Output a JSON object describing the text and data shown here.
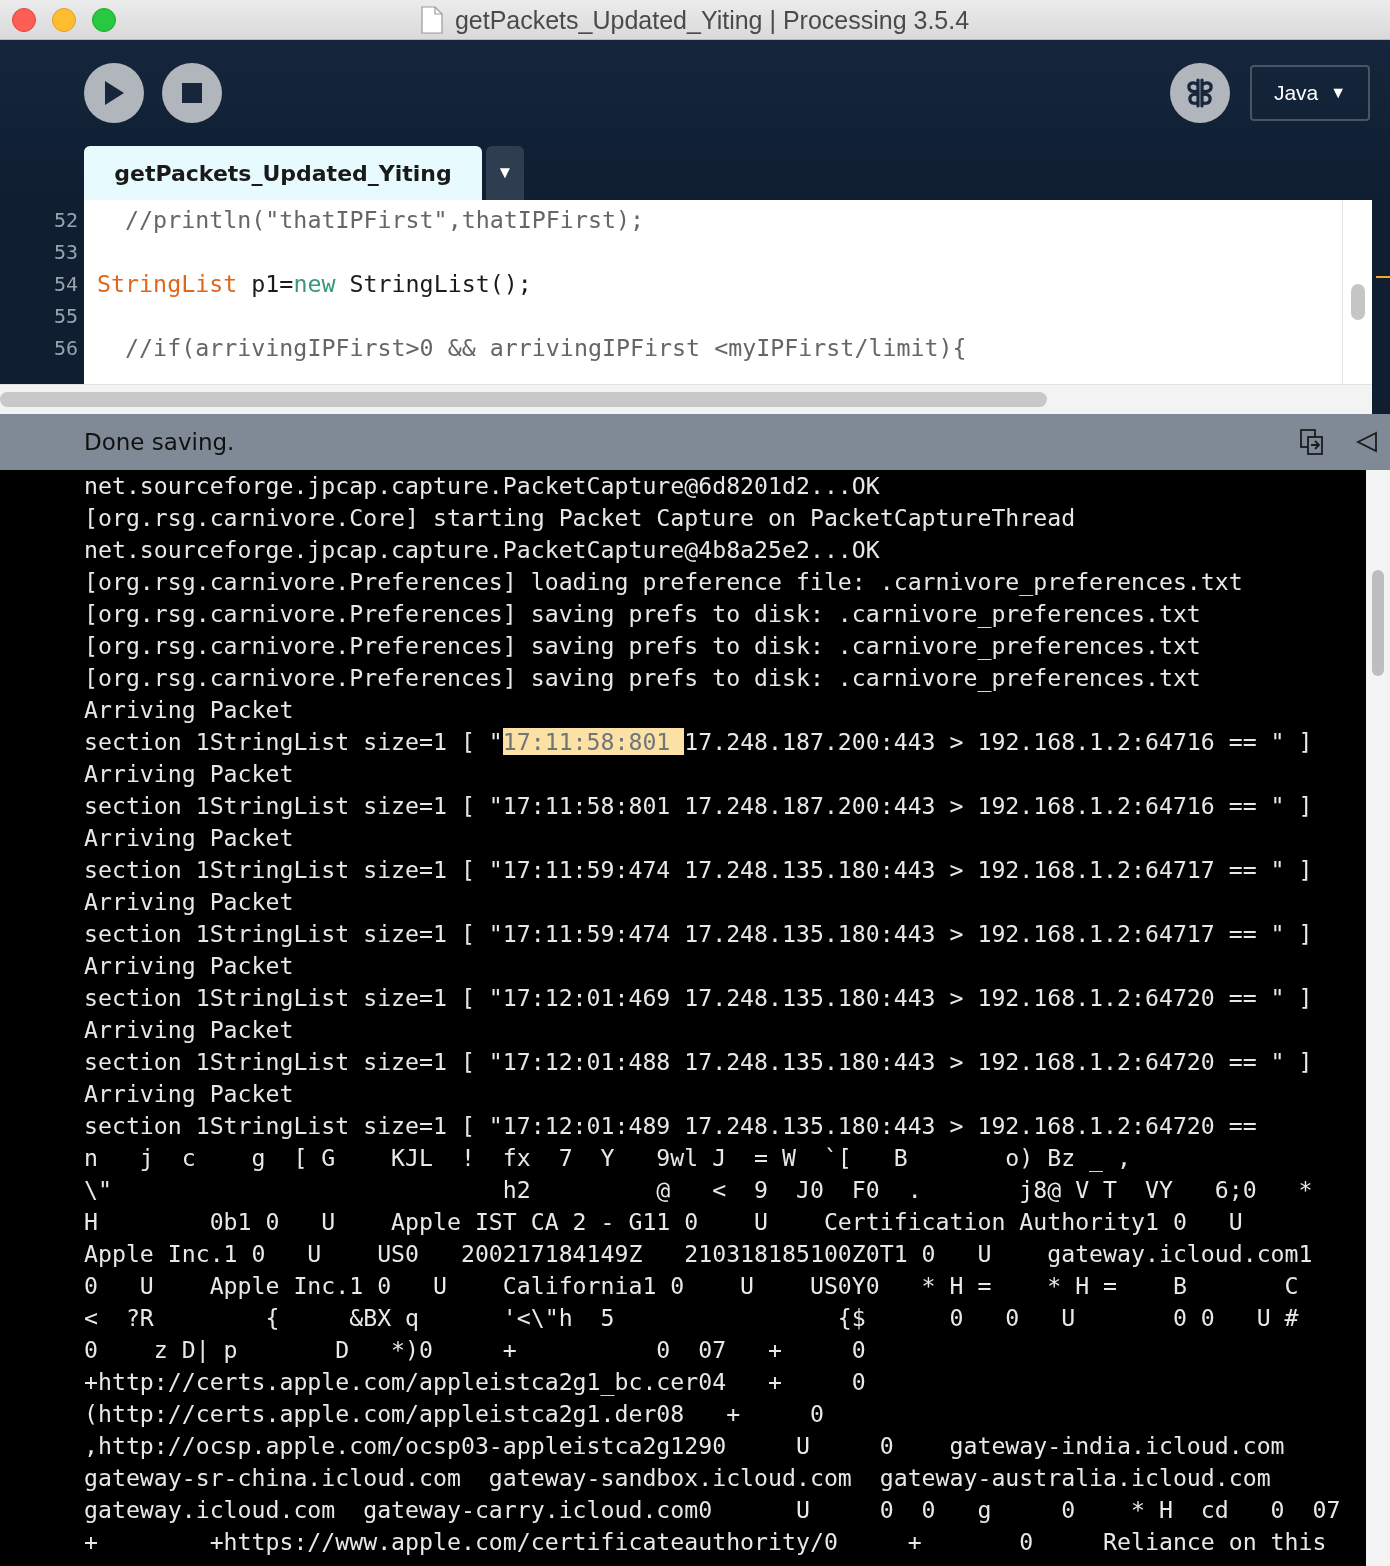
{
  "window": {
    "title": "getPackets_Updated_Yiting | Processing 3.5.4"
  },
  "toolbar": {
    "mode_selector": {
      "label": "Java",
      "arrow": "▼"
    }
  },
  "tab": {
    "label": "getPackets_Updated_Yiting",
    "selected": true,
    "menu_arrow": "▼"
  },
  "editor": {
    "lines": [
      {
        "number": "52",
        "tokens": [
          {
            "kind": "comment",
            "text": "  //println(\"thatIPFirst\",thatIPFirst);"
          }
        ]
      },
      {
        "number": "53"
      },
      {
        "number": "54",
        "tokens": [
          {
            "kind": "type",
            "text": "StringList"
          },
          {
            "kind": "plain",
            "text": " p1="
          },
          {
            "kind": "keyword",
            "text": "new"
          },
          {
            "kind": "plain",
            "text": " StringList();"
          }
        ]
      },
      {
        "number": "55"
      },
      {
        "number": "56",
        "tokens": [
          {
            "kind": "comment",
            "text": "  //if(arrivingIPFirst>0 && arrivingIPFirst <myIPFirst/limit){"
          }
        ]
      }
    ]
  },
  "status_bar": {
    "message": "Done saving."
  },
  "console": {
    "lines": [
      {
        "text": "net.sourceforge.jpcap.capture.PacketCapture@6d8201d2...OK"
      },
      {
        "text": "[org.rsg.carnivore.Core] starting Packet Capture on PacketCaptureThread"
      },
      {
        "text": "net.sourceforge.jpcap.capture.PacketCapture@4b8a25e2...OK"
      },
      {
        "text": "[org.rsg.carnivore.Preferences] loading preference file: .carnivore_preferences.txt"
      },
      {
        "text": "[org.rsg.carnivore.Preferences] saving prefs to disk: .carnivore_preferences.txt"
      },
      {
        "text": "[org.rsg.carnivore.Preferences] saving prefs to disk: .carnivore_preferences.txt"
      },
      {
        "text": "[org.rsg.carnivore.Preferences] saving prefs to disk: .carnivore_preferences.txt"
      },
      {
        "text": "Arriving Packet"
      },
      {
        "text": "section 1StringList size=1 [ \"",
        "marked": "17:11:58:801 ",
        "rest": "17.248.187.200:443 > 192.168.1.2:64716 == \" ]"
      },
      {
        "text": "Arriving Packet"
      },
      {
        "text": "section 1StringList size=1 [ \"17:11:58:801 17.248.187.200:443 > 192.168.1.2:64716 == \" ]"
      },
      {
        "text": "Arriving Packet"
      },
      {
        "text": "section 1StringList size=1 [ \"17:11:59:474 17.248.135.180:443 > 192.168.1.2:64717 == \" ]"
      },
      {
        "text": "Arriving Packet"
      },
      {
        "text": "section 1StringList size=1 [ \"17:11:59:474 17.248.135.180:443 > 192.168.1.2:64717 == \" ]"
      },
      {
        "text": "Arriving Packet"
      },
      {
        "text": "section 1StringList size=1 [ \"17:12:01:469 17.248.135.180:443 > 192.168.1.2:64720 == \" ]"
      },
      {
        "text": "Arriving Packet"
      },
      {
        "text": "section 1StringList size=1 [ \"17:12:01:488 17.248.135.180:443 > 192.168.1.2:64720 == \" ]"
      },
      {
        "text": "Arriving Packet"
      },
      {
        "text": "section 1StringList size=1 [ \"17:12:01:489 17.248.135.180:443 > 192.168.1.2:64720 =="
      },
      {
        "text": "n   j  c    g  [ G    KJL  !  fx  7  Y   9wl J  = W  `[   B       o) Bz _ ,"
      },
      {
        "text": "\\\"                            h2         @   <  9  J0  F0  .       j8@ V T  VY   6;0   *"
      },
      {
        "text": "H        0b1 0   U    Apple IST CA 2 - G11 0    U    Certification Authority1 0   U"
      },
      {
        "text": "Apple Inc.1 0   U    US0   200217184149Z   210318185100Z0T1 0   U    gateway.icloud.com1"
      },
      {
        "text": "0   U    Apple Inc.1 0   U    California1 0    U    US0Y0   * H =    * H =    B       C"
      },
      {
        "text": "<  ?R        {     &BX q      '<\\\"h  5                {$      0   0   U       0 0   U #"
      },
      {
        "text": "0    z D| p       D   *)0     +          0  07   +     0"
      },
      {
        "text": "+http://certs.apple.com/appleistca2g1_bc.cer04   +     0"
      },
      {
        "text": "(http://certs.apple.com/appleistca2g1.der08   +     0"
      },
      {
        "text": ",http://ocsp.apple.com/ocsp03-appleistca2g1290     U     0    gateway-india.icloud.com"
      },
      {
        "text": "gateway-sr-china.icloud.com  gateway-sandbox.icloud.com  gateway-australia.icloud.com"
      },
      {
        "text": "gateway.icloud.com  gateway-carry.icloud.com0      U     0  0   g     0    * H  cd   0  07"
      },
      {
        "text": "+        +https://www.apple.com/certificateauthority/0     +       0     Reliance on this"
      }
    ]
  }
}
